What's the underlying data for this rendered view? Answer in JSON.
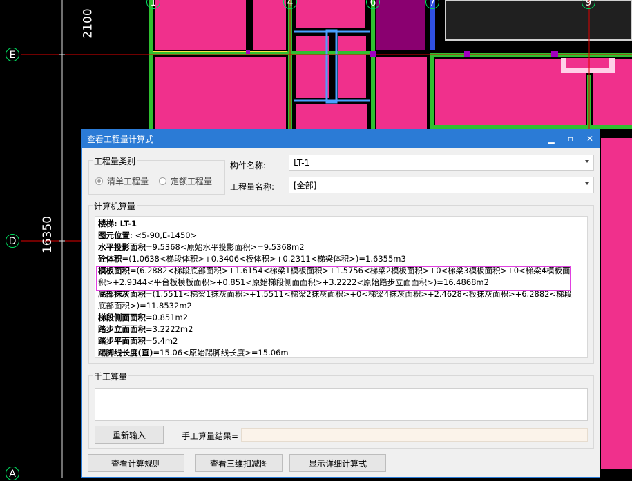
{
  "cad": {
    "dim_top": "2100",
    "dim_left": "16350",
    "axis_rows": [
      "E",
      "D",
      "A"
    ],
    "axis_cols": [
      "1",
      "4",
      "6",
      "7",
      "9"
    ],
    "colors": {
      "slab": "#f0308c",
      "beam": "#30c030",
      "purple": "#8a0070",
      "grid": "#e00000"
    }
  },
  "dialog": {
    "title": "查看工程量计算式",
    "controls": {
      "minimize": "▁",
      "maximize": "▫",
      "close": "✕"
    },
    "quantity_type": {
      "title": "工程量类别",
      "options": [
        {
          "label": "清单工程量",
          "selected": true
        },
        {
          "label": "定额工程量",
          "selected": false
        }
      ]
    },
    "component_name": {
      "label": "构件名称:",
      "value": "LT-1"
    },
    "quantity_name": {
      "label": "工程量名称:",
      "value": "[全部]"
    },
    "computer_calc": {
      "title": "计算机算量",
      "lines": [
        {
          "key": "楼梯: LT-1",
          "text": ""
        },
        {
          "key": "图元位置",
          "text": ": <5-90,E-1450>"
        },
        {
          "key": "水平投影面积",
          "text": "=9.5368<原始水平投影面积>=9.5368m2"
        },
        {
          "key": "砼体积",
          "text": "=(1.0638<梯段体积>+0.3406<板体积>+0.2311<梯梁体积>)=1.6355m3"
        },
        {
          "key": "模板面积",
          "text": "=(6.2882<梯段底部面积>+1.6154<梯梁1模板面积>+1.5756<梯梁2模板面积>+0<梯梁3模板面积>+0<梯梁4模板面"
        },
        {
          "key": "",
          "text": "积>+2.9344<平台板模板面积>+0.851<原始梯段侧面面积>+3.2222<原始踏步立面面积>)=16.4868m2"
        },
        {
          "key": "底部抹灰面积",
          "text": "=(1.5511<梯梁1抹灰面积>+1.5511<梯梁2抹灰面积>+0<梯梁4抹灰面积>+2.4628<板抹灰面积>+6.2882<梯段"
        },
        {
          "key": "",
          "text": "底部面积>)=11.8532m2"
        },
        {
          "key": "梯段侧面面积",
          "text": "=0.851m2"
        },
        {
          "key": "踏步立面面积",
          "text": "=3.2222m2"
        },
        {
          "key": "踏步平面面积",
          "text": "=5.4m2"
        },
        {
          "key": "踢脚线长度(直)",
          "text": "=15.06<原始踢脚线长度>=15.06m"
        }
      ]
    },
    "manual_calc": {
      "title": "手工算量",
      "reenter_button": "重新输入",
      "result_label": "手工算量结果="
    },
    "footer_buttons": [
      "查看计算规则",
      "查看三维扣减图",
      "显示详细计算式"
    ]
  }
}
